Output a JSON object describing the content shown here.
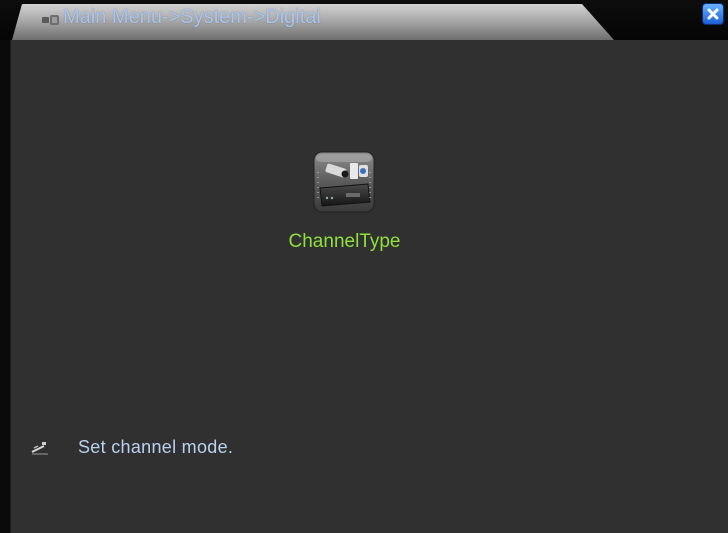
{
  "window": {
    "breadcrumb": "Main Menu->System->Digital",
    "close_icon": "close-icon"
  },
  "menu": {
    "items": [
      {
        "label": "ChannelType",
        "icon": "camera-dvr-icon"
      }
    ]
  },
  "status": {
    "icon": "info-pen-icon",
    "text": "Set channel mode."
  },
  "colors": {
    "breadcrumb": "#a9c6f2",
    "menu_label": "#8ee03a",
    "status_text": "#b9d0f0",
    "background": "#303030"
  }
}
